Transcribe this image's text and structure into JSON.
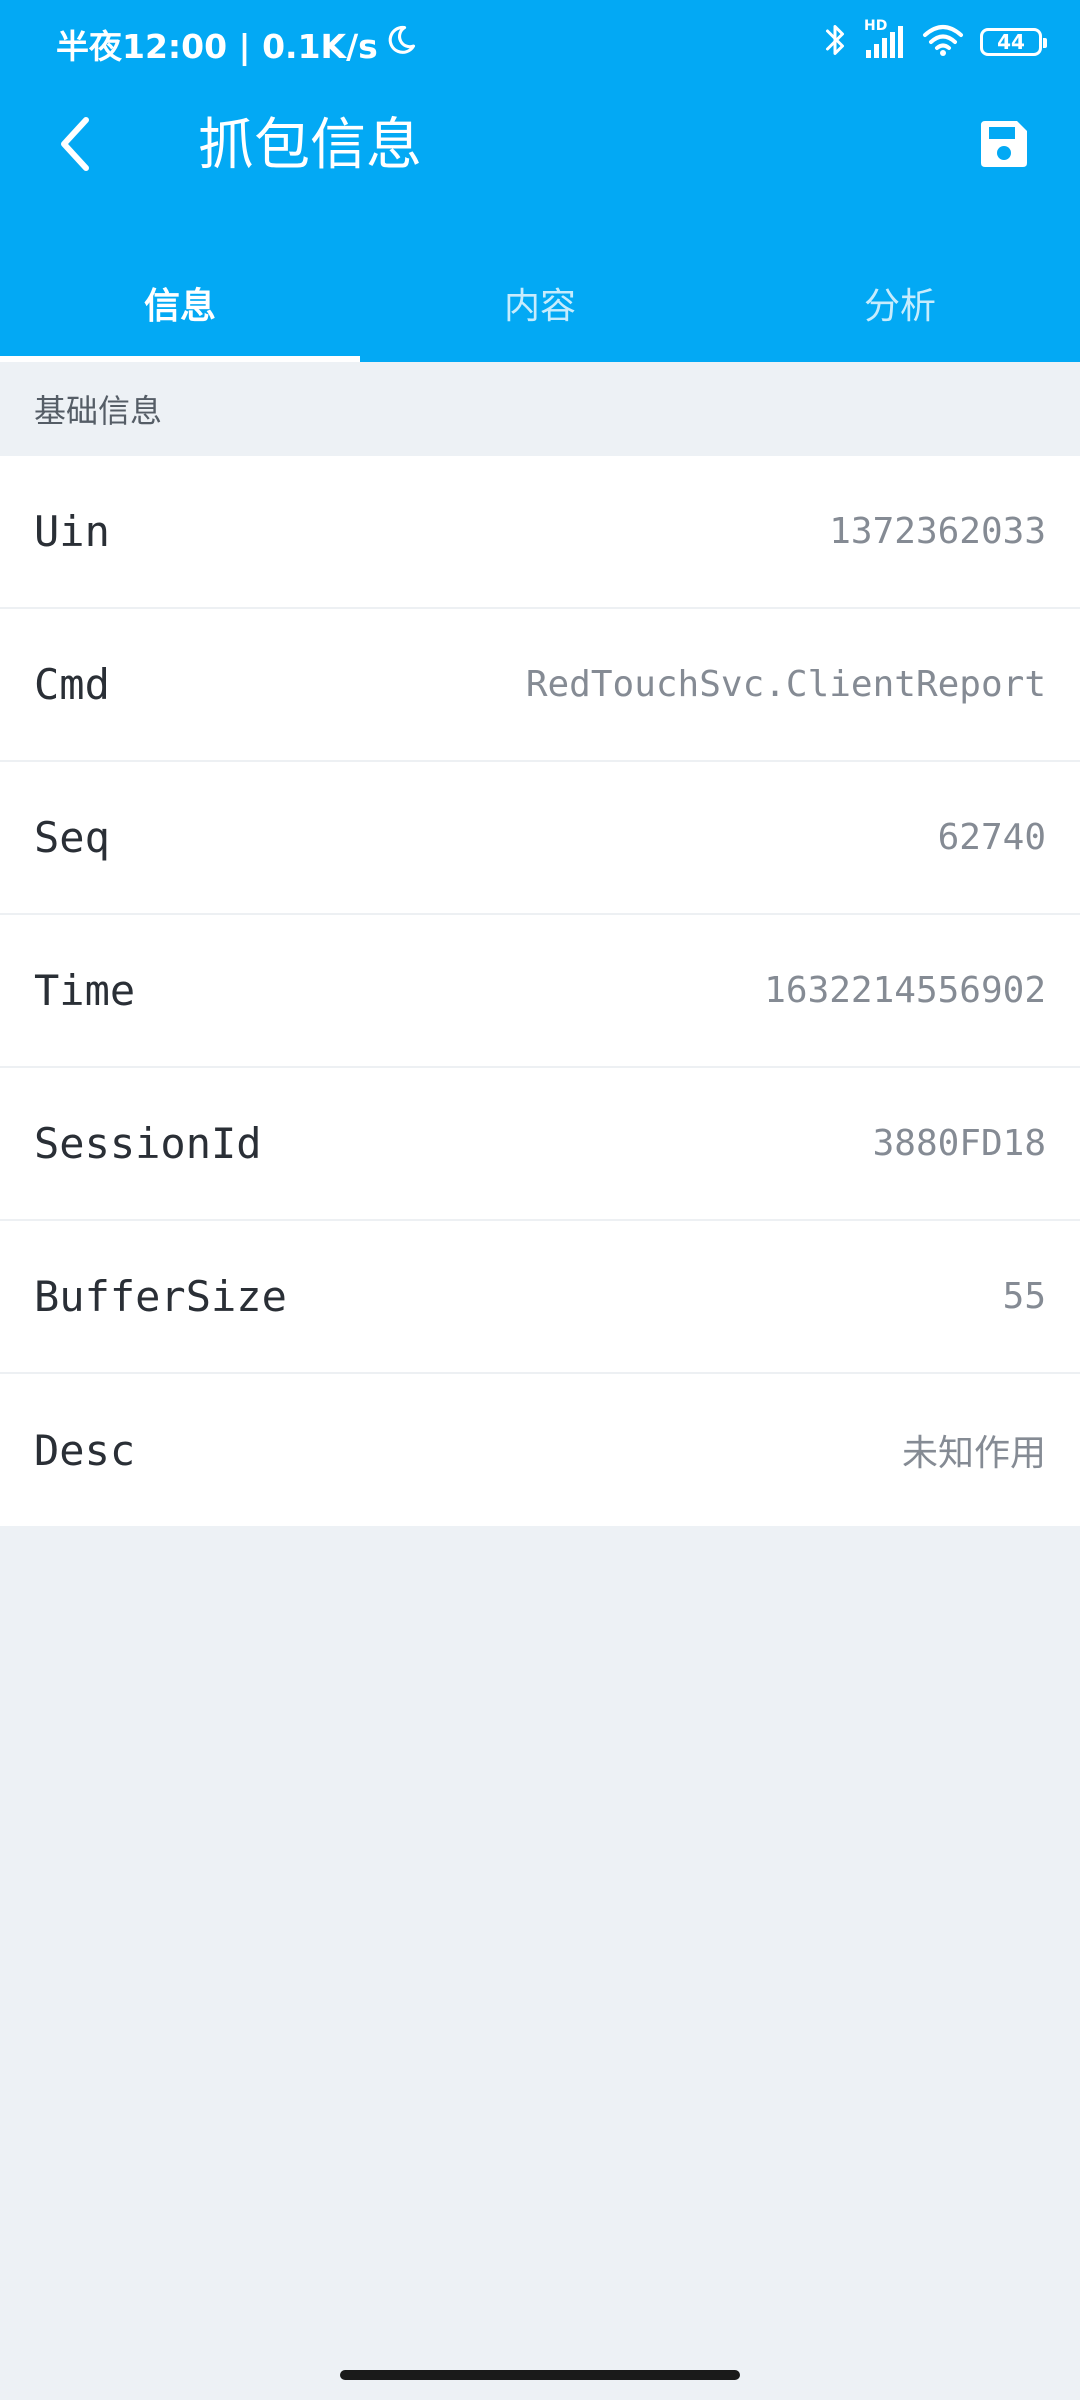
{
  "status_bar": {
    "time_text": "半夜12:00 | 0.1K/s",
    "battery_level": "44",
    "network_label": "HD",
    "icons": [
      "moon-icon",
      "bluetooth-icon",
      "signal-icon",
      "wifi-icon",
      "battery-icon"
    ]
  },
  "app_bar": {
    "title": "抓包信息",
    "back_icon": "chevron-left-icon",
    "save_icon": "save-icon"
  },
  "tabs": [
    {
      "label": "信息",
      "active": true
    },
    {
      "label": "内容",
      "active": false
    },
    {
      "label": "分析",
      "active": false
    }
  ],
  "section": {
    "title": "基础信息"
  },
  "rows": [
    {
      "label": "Uin",
      "value": "1372362033"
    },
    {
      "label": "Cmd",
      "value": "RedTouchSvc.ClientReport"
    },
    {
      "label": "Seq",
      "value": "62740"
    },
    {
      "label": "Time",
      "value": "1632214556902"
    },
    {
      "label": "SessionId",
      "value": "3880FD18"
    },
    {
      "label": "BufferSize",
      "value": "55"
    },
    {
      "label": "Desc",
      "value": "未知作用"
    }
  ],
  "colors": {
    "primary": "#03a9f4",
    "background": "#edf1f5",
    "label_text": "#2a2f36",
    "value_text": "#858b94"
  }
}
